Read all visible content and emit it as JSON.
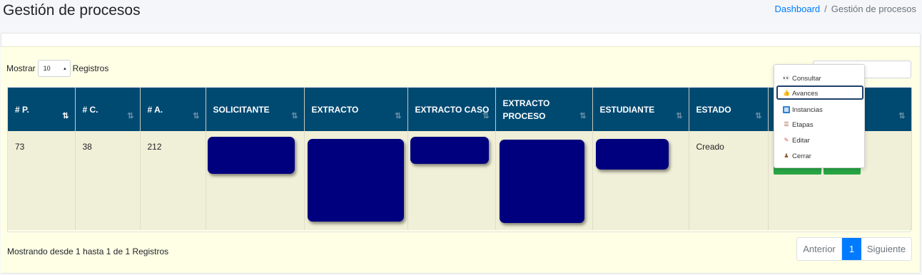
{
  "header": {
    "title": "Gestión de procesos",
    "breadcrumb": {
      "home": "Dashboard",
      "separator": "/",
      "current": "Gestión de procesos"
    }
  },
  "length_menu": {
    "before": "Mostrar",
    "value": "10",
    "after": "Registros"
  },
  "table": {
    "columns": [
      "# P.",
      "# C.",
      "# A.",
      "SOLICITANTE",
      "EXTRACTO",
      "EXTRACTO CASO",
      "EXTRACTO PROCESO",
      "ESTUDIANTE",
      "ESTADO",
      ""
    ],
    "rows": [
      {
        "p": "73",
        "c": "38",
        "a": "212",
        "estado": "Creado"
      }
    ]
  },
  "dropdown": {
    "items": [
      {
        "label": "Consultar",
        "icon": "eyes-icon"
      },
      {
        "label": "Avances",
        "icon": "thumbs-up-icon",
        "highlighted": true
      },
      {
        "label": "Instancias",
        "icon": "grid-icon"
      },
      {
        "label": "Etapas",
        "icon": "ladder-icon"
      },
      {
        "label": "Editar",
        "icon": "edit-icon"
      },
      {
        "label": "Cerrar",
        "icon": "person-icon"
      }
    ]
  },
  "footer": {
    "info": "Mostrando desde 1 hasta 1 de 1 Registros",
    "prev": "Anterior",
    "page": "1",
    "next": "Siguiente"
  },
  "colors": {
    "header_bg": "#004a72",
    "accent": "#007bff",
    "row_bg": "#f0efd7",
    "redaction": "#00007e",
    "action_green": "#28a745"
  }
}
